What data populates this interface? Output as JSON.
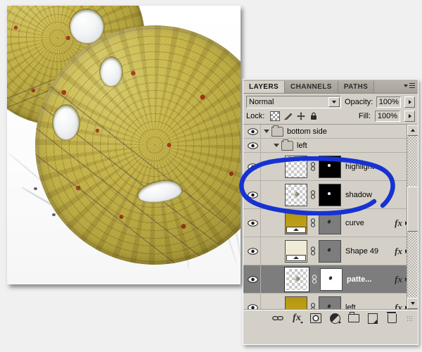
{
  "panel": {
    "tabs": [
      {
        "label": "LAYERS",
        "active": true
      },
      {
        "label": "CHANNELS",
        "active": false
      },
      {
        "label": "PATHS",
        "active": false
      }
    ],
    "menu_icon": "panel-menu-icon",
    "blend_mode": "Normal",
    "opacity_label": "Opacity:",
    "opacity_value": "100%",
    "lock_label": "Lock:",
    "lock_icons": [
      "lock-transparent-pixels-icon",
      "lock-image-pixels-icon",
      "lock-position-icon",
      "lock-all-icon"
    ],
    "fill_label": "Fill:",
    "fill_value": "100%",
    "footer_buttons": [
      "link-layers-icon",
      "add-layer-style-icon",
      "add-layer-mask-icon",
      "new-adjustment-layer-icon",
      "new-group-icon",
      "new-layer-icon",
      "delete-layer-icon"
    ]
  },
  "layers": [
    {
      "name": "bottom side",
      "type": "group",
      "indent": 0,
      "visible": true,
      "expanded": true,
      "selected": false,
      "fx": false
    },
    {
      "name": "left",
      "type": "group",
      "indent": 1,
      "visible": true,
      "expanded": true,
      "selected": false,
      "fx": false
    },
    {
      "name": "highlight",
      "type": "layer",
      "indent": 2,
      "visible": true,
      "selected": false,
      "thumb": "transparent",
      "mask": "black",
      "linked": true,
      "fx": false
    },
    {
      "name": "shadow",
      "type": "layer",
      "indent": 2,
      "visible": true,
      "selected": false,
      "thumb": "transparent",
      "mask": "black",
      "linked": true,
      "fx": false
    },
    {
      "name": "curve",
      "type": "layer",
      "indent": 2,
      "visible": true,
      "selected": false,
      "thumb": "gold-gradient",
      "mask": "gray",
      "linked": true,
      "fx": true
    },
    {
      "name": "Shape 49",
      "type": "layer",
      "indent": 2,
      "visible": true,
      "selected": false,
      "thumb": "cream-gradient",
      "mask": "gray",
      "linked": true,
      "fx": true
    },
    {
      "name": "patte...",
      "type": "layer",
      "indent": 2,
      "visible": true,
      "selected": true,
      "thumb": "transparent",
      "mask": "white",
      "linked": true,
      "fx": true
    },
    {
      "name": "left",
      "type": "layer",
      "indent": 2,
      "visible": true,
      "selected": false,
      "thumb": "gold-gradient",
      "mask": "gray",
      "linked": true,
      "fx": true
    }
  ],
  "annotation": {
    "shape": "ellipse",
    "color": "#1632d2",
    "encircles": [
      "highlight",
      "shadow"
    ]
  },
  "artwork": {
    "description": "Two overlapping ornate gold discs with red filigree inlay on white sketch paper",
    "colors": {
      "gold": "#c0ad3e",
      "gold_dark": "#8d7f28",
      "red_inlay": "#c4241e",
      "paper": "#ffffff"
    }
  },
  "colors": {
    "panel_bg": "#d4d0c8",
    "panel_tab_inactive": "#aba79f",
    "selection": "#7d7d7d",
    "app_bg": "#f0f0f0"
  }
}
